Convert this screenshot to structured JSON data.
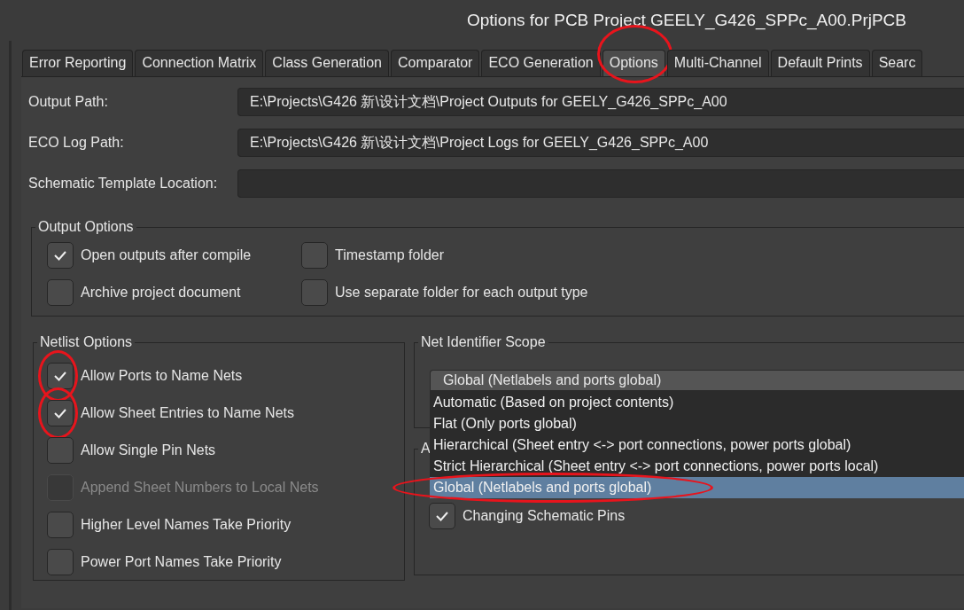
{
  "window": {
    "title": "Options for PCB Project GEELY_G426_SPPc_A00.PrjPCB"
  },
  "tabs": [
    {
      "label": "Error Reporting",
      "selected": false,
      "circled": false
    },
    {
      "label": "Connection Matrix",
      "selected": false,
      "circled": false
    },
    {
      "label": "Class Generation",
      "selected": false,
      "circled": false
    },
    {
      "label": "Comparator",
      "selected": false,
      "circled": false
    },
    {
      "label": "ECO Generation",
      "selected": false,
      "circled": false
    },
    {
      "label": "Options",
      "selected": true,
      "circled": true
    },
    {
      "label": "Multi-Channel",
      "selected": false,
      "circled": false
    },
    {
      "label": "Default Prints",
      "selected": false,
      "circled": false
    },
    {
      "label": "Searc",
      "selected": false,
      "circled": false
    }
  ],
  "paths": [
    {
      "label": "Output Path:",
      "value": "E:\\Projects\\G426 新\\设计文档\\Project Outputs for GEELY_G426_SPPc_A00"
    },
    {
      "label": "ECO Log Path:",
      "value": "E:\\Projects\\G426 新\\设计文档\\Project Logs for GEELY_G426_SPPc_A00"
    },
    {
      "label": "Schematic Template Location:"
    }
  ],
  "output_options": {
    "title": "Output Options",
    "items": [
      {
        "label": "Open outputs after compile",
        "checked": true
      },
      {
        "label": "Timestamp folder",
        "checked": false
      },
      {
        "label": "Archive project document",
        "checked": false
      },
      {
        "label": "Use separate folder for each output type",
        "checked": false
      }
    ]
  },
  "netlist_options": {
    "title": "Netlist Options",
    "items": [
      {
        "label": "Allow Ports to Name Nets",
        "checked": true,
        "disabled": false,
        "circled": true
      },
      {
        "label": "Allow Sheet Entries to Name Nets",
        "checked": true,
        "disabled": false,
        "circled": true
      },
      {
        "label": "Allow Single Pin Nets",
        "checked": false,
        "disabled": false,
        "circled": false
      },
      {
        "label": "Append Sheet Numbers to Local Nets",
        "checked": false,
        "disabled": true,
        "circled": false
      },
      {
        "label": "Higher Level Names Take Priority",
        "checked": false,
        "disabled": false,
        "circled": false
      },
      {
        "label": "Power Port Names Take Priority",
        "checked": false,
        "disabled": false,
        "circled": false
      }
    ]
  },
  "net_identifier_scope": {
    "title": "Net Identifier Scope",
    "value": "Global (Netlabels and ports global)",
    "options": [
      {
        "label": "Automatic (Based on project contents)",
        "selected": false,
        "circled": false
      },
      {
        "label": "Flat (Only ports global)",
        "selected": false,
        "circled": false
      },
      {
        "label": "Hierarchical (Sheet entry <-> port connections, power ports global)",
        "selected": false,
        "circled": false
      },
      {
        "label": "Strict Hierarchical (Sheet entry <-> port connections, power ports local)",
        "selected": false,
        "circled": false
      },
      {
        "label": "Global (Netlabels and ports global)",
        "selected": true,
        "circled": true
      }
    ]
  },
  "group_2": {
    "title": "A",
    "items": [
      {
        "label": "Changing Schematic Pins",
        "checked": true
      }
    ]
  }
}
